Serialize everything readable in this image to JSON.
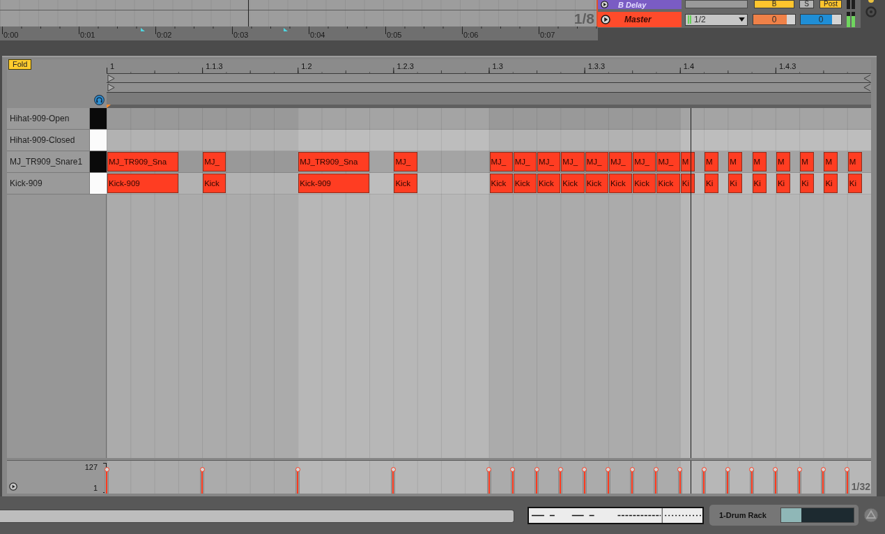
{
  "clip_overview": {
    "grid_label": "1/8",
    "playhead": {
      "level": 0.416
    }
  },
  "time_ruler": [
    "0:00",
    "0:01",
    "0:02",
    "0:03",
    "0:04",
    "0:05",
    "0:06",
    "0:07"
  ],
  "mixer_rows": [
    {
      "kind": "return",
      "name": "B Delay",
      "color": "#7a5cc4",
      "buttons": [
        {
          "label": "B",
          "on": true
        },
        {
          "label": "S",
          "on": false
        },
        {
          "label": "Post",
          "on": true
        }
      ]
    },
    {
      "kind": "master",
      "name": "Master",
      "color": "#ff4b2b",
      "dropdown": "1/2",
      "fields": [
        {
          "value": "0",
          "level": 0.8,
          "color": "#ef8148"
        },
        {
          "value": "0",
          "level": 0.78,
          "color": "#1f8ed6"
        }
      ],
      "meter": {
        "level": 0.75
      }
    }
  ],
  "fold_button": {
    "label": "Fold",
    "on": true
  },
  "ruler": [
    "1",
    "1.1.3",
    "1.2",
    "1.2.3",
    "1.3",
    "1.3.3",
    "1.4",
    "1.4.3"
  ],
  "lanes": [
    {
      "name": "Hihat-909-Open",
      "kind": "black"
    },
    {
      "name": "Hihat-909-Closed",
      "kind": "white"
    },
    {
      "name": "MJ_TR909_Snare1",
      "kind": "black",
      "slots": [
        {
          "kind": "long",
          "label": "MJ_TR909_Sna"
        },
        {
          "kind": "rest"
        },
        {
          "kind": "note",
          "label": "MJ_"
        },
        {
          "kind": "rest"
        },
        {
          "kind": "rest"
        },
        {
          "kind": "rest"
        },
        {
          "kind": "long",
          "label": "MJ_TR909_Sna"
        },
        {
          "kind": "rest"
        },
        {
          "kind": "note",
          "label": "MJ_"
        },
        {
          "kind": "rest"
        },
        {
          "kind": "rest"
        },
        {
          "kind": "rest"
        },
        {
          "kind": "note",
          "label": "MJ_"
        },
        {
          "kind": "note",
          "label": "MJ_"
        },
        {
          "kind": "note",
          "label": "MJ_"
        },
        {
          "kind": "note",
          "label": "MJ_"
        },
        {
          "kind": "note",
          "label": "MJ_"
        },
        {
          "kind": "note",
          "label": "MJ_"
        },
        {
          "kind": "note",
          "label": "MJ_"
        },
        {
          "kind": "note",
          "label": "MJ_"
        },
        {
          "kind": "short",
          "label": "M"
        },
        {
          "kind": "short",
          "label": "M"
        },
        {
          "kind": "short",
          "label": "M"
        },
        {
          "kind": "short",
          "label": "M"
        },
        {
          "kind": "short",
          "label": "M"
        },
        {
          "kind": "short",
          "label": "M"
        },
        {
          "kind": "short",
          "label": "M"
        },
        {
          "kind": "short",
          "label": "M"
        }
      ]
    },
    {
      "name": "Kick-909",
      "kind": "white",
      "slots": [
        {
          "kind": "long",
          "label": "Kick-909"
        },
        {
          "kind": "rest"
        },
        {
          "kind": "note",
          "label": "Kick"
        },
        {
          "kind": "rest"
        },
        {
          "kind": "rest"
        },
        {
          "kind": "rest"
        },
        {
          "kind": "long",
          "label": "Kick-909"
        },
        {
          "kind": "rest"
        },
        {
          "kind": "note",
          "label": "Kick"
        },
        {
          "kind": "rest"
        },
        {
          "kind": "rest"
        },
        {
          "kind": "rest"
        },
        {
          "kind": "note",
          "label": "Kick"
        },
        {
          "kind": "note",
          "label": "Kick"
        },
        {
          "kind": "note",
          "label": "Kick"
        },
        {
          "kind": "note",
          "label": "Kick"
        },
        {
          "kind": "note",
          "label": "Kick"
        },
        {
          "kind": "note",
          "label": "Kick"
        },
        {
          "kind": "note",
          "label": "Kick"
        },
        {
          "kind": "note",
          "label": "Kick"
        },
        {
          "kind": "short",
          "label": "Ki"
        },
        {
          "kind": "short",
          "label": "Ki"
        },
        {
          "kind": "short",
          "label": "Ki"
        },
        {
          "kind": "short",
          "label": "Ki"
        },
        {
          "kind": "short",
          "label": "Ki"
        },
        {
          "kind": "short",
          "label": "Ki"
        },
        {
          "kind": "short",
          "label": "Ki"
        },
        {
          "kind": "short",
          "label": "Ki"
        }
      ]
    }
  ],
  "playhead": {
    "level": 0.764
  },
  "velocity": {
    "max_label": "127",
    "min_label": "1",
    "grid_label": "1/32",
    "slots": [
      {
        "kind": "marker",
        "level": 1
      },
      {
        "kind": "rest"
      },
      {
        "kind": "rest"
      },
      {
        "kind": "rest"
      },
      {
        "kind": "marker",
        "level": 1
      },
      {
        "kind": "rest"
      },
      {
        "kind": "rest"
      },
      {
        "kind": "rest"
      },
      {
        "kind": "marker",
        "level": 1
      },
      {
        "kind": "rest"
      },
      {
        "kind": "rest"
      },
      {
        "kind": "rest"
      },
      {
        "kind": "marker",
        "level": 1
      },
      {
        "kind": "rest"
      },
      {
        "kind": "rest"
      },
      {
        "kind": "rest"
      },
      {
        "kind": "marker",
        "level": 1
      },
      {
        "kind": "marker",
        "level": 1
      },
      {
        "kind": "marker",
        "level": 1
      },
      {
        "kind": "marker",
        "level": 1
      },
      {
        "kind": "marker",
        "level": 1
      },
      {
        "kind": "marker",
        "level": 1
      },
      {
        "kind": "marker",
        "level": 1
      },
      {
        "kind": "marker",
        "level": 1
      },
      {
        "kind": "marker",
        "level": 1
      },
      {
        "kind": "marker",
        "level": 1
      },
      {
        "kind": "marker",
        "level": 1
      },
      {
        "kind": "marker",
        "level": 1
      },
      {
        "kind": "marker",
        "level": 1
      },
      {
        "kind": "marker",
        "level": 1
      },
      {
        "kind": "marker",
        "level": 1
      },
      {
        "kind": "marker",
        "level": 1
      }
    ]
  },
  "device": {
    "name": "1-Drum Rack"
  }
}
